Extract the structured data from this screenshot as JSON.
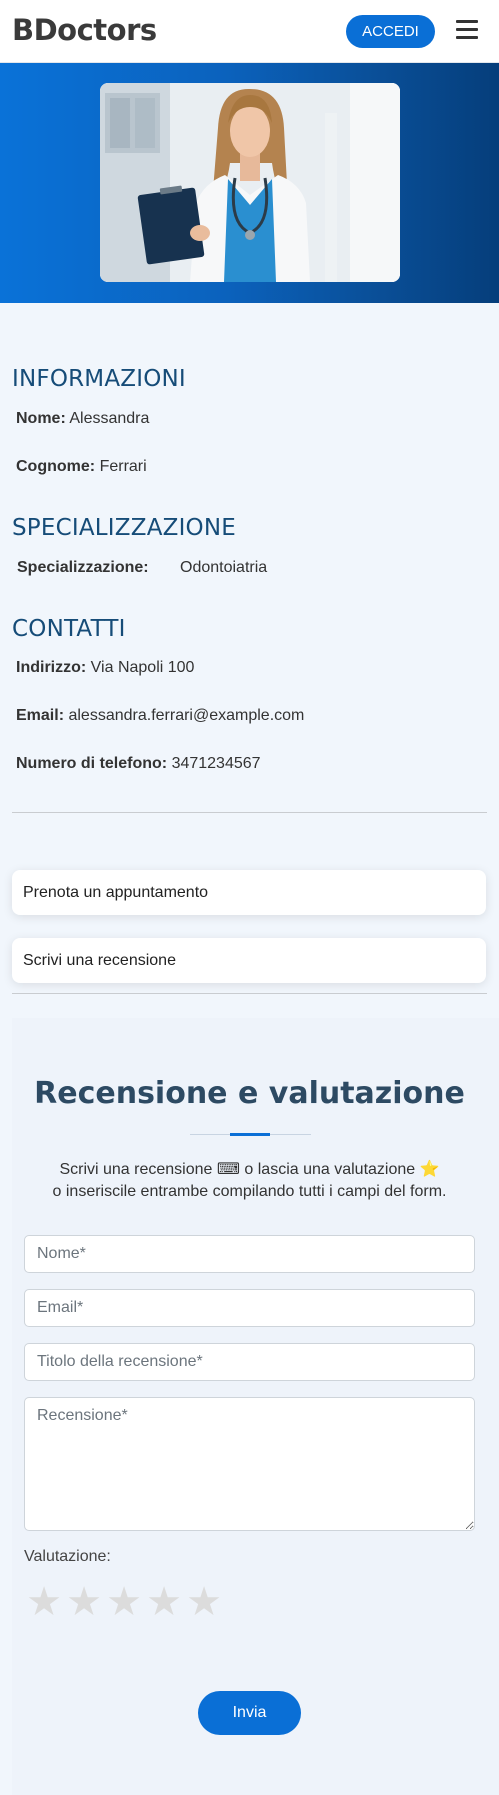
{
  "header": {
    "brand": "BDoctors",
    "login_label": "ACCEDI"
  },
  "info": {
    "title": "INFORMAZIONI",
    "name_label": "Nome:",
    "name_value": "Alessandra",
    "surname_label": "Cognome:",
    "surname_value": "Ferrari"
  },
  "specialization": {
    "title": "SPECIALIZZAZIONE",
    "label": "Specializzazione:",
    "value": "Odontoiatria"
  },
  "contacts": {
    "title": "CONTATTI",
    "address_label": "Indirizzo:",
    "address_value": "Via Napoli 100",
    "email_label": "Email:",
    "email_value": "alessandra.ferrari@example.com",
    "phone_label": "Numero di telefono:",
    "phone_value": "3471234567"
  },
  "actions": {
    "book_label": "Prenota un appuntamento",
    "review_label": "Scrivi una recensione"
  },
  "review": {
    "title": "Recensione e valutazione",
    "subtitle_line1": "Scrivi una recensione ⌨ o lascia una valutazione ⭐",
    "subtitle_line2": "o inseriscile entrambe compilando tutti i campi del form.",
    "name_placeholder": "Nome*",
    "email_placeholder": "Email*",
    "subject_placeholder": "Titolo della recensione*",
    "text_placeholder": "Recensione*",
    "rating_label": "Valutazione:",
    "rating_value": 0,
    "rating_max": 5,
    "submit_label": "Invia"
  },
  "colors": {
    "accent": "#0a6fd6",
    "section_title": "#164c78",
    "star_empty": "#dcdcdc"
  }
}
